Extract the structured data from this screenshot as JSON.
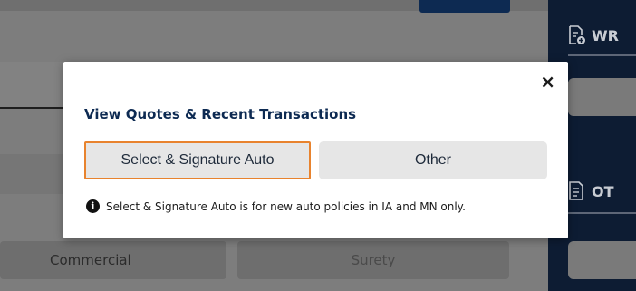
{
  "background": {
    "tabs": [
      {
        "label": "Commercial"
      },
      {
        "label": "Surety"
      }
    ],
    "sidebar": {
      "sections": [
        {
          "label": "WR",
          "icon": "document-add-icon"
        },
        {
          "label": "OT",
          "icon": "document-list-icon"
        }
      ]
    }
  },
  "modal": {
    "title": "View Quotes & Recent Transactions",
    "close_label": "×",
    "options": [
      {
        "label": "Select & Signature Auto",
        "selected": true
      },
      {
        "label": "Other",
        "selected": false
      }
    ],
    "info_icon": "info-icon",
    "info_text": "Select & Signature Auto is for new auto policies in IA and MN only."
  },
  "colors": {
    "overlay": "#7d7d7d",
    "navy": "#0d2a52",
    "sidebar": "#0d1c33",
    "selected_border": "#e8832e",
    "button_bg": "#e6e6e6"
  }
}
